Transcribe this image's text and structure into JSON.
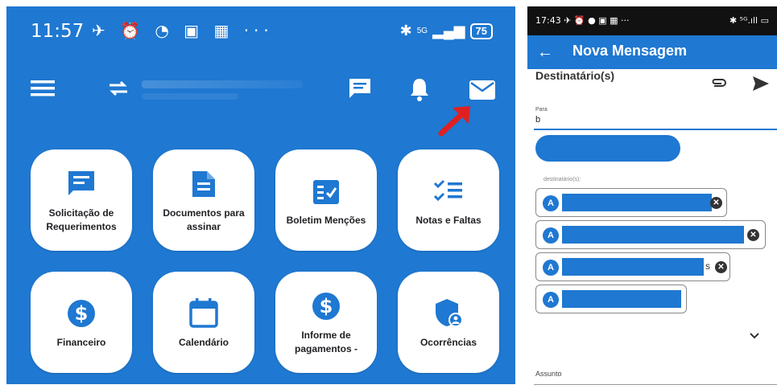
{
  "left_screen": {
    "status_bar": {
      "time": "11:57",
      "icons": "✈ ⏰ ◔ ▣ ▦ ···",
      "network": "5G",
      "battery": "75"
    },
    "app_bar": {
      "menu_icon": "menu-icon",
      "swap_icon": "swap-icon",
      "chat_icon": "chat-icon",
      "bell_icon": "bell-icon",
      "mail_icon": "mail-icon"
    },
    "tiles": [
      {
        "label": "Solicitação de\nRequerimentos",
        "icon": "chat-bubble-icon"
      },
      {
        "label": "Documentos para\nassinar",
        "icon": "document-icon"
      },
      {
        "label": "Boletim Menções",
        "icon": "grade-report-icon"
      },
      {
        "label": "Notas e Faltas",
        "icon": "checklist-icon"
      },
      {
        "label": "Financeiro",
        "icon": "dollar-icon"
      },
      {
        "label": "Calendário",
        "icon": "calendar-icon"
      },
      {
        "label": "Informe de\npagamentos -",
        "icon": "dollar-icon"
      },
      {
        "label": "Ocorrências",
        "icon": "shield-user-icon"
      }
    ]
  },
  "right_screen": {
    "status_bar": {
      "time": "17:43",
      "icons": "✈ ⏰ ● ▣ ▦ ···",
      "signal": "✱ ⁵ᴳ.ıll ▭"
    },
    "app_bar": {
      "back_label": "←",
      "title": "Nova Mensagem"
    },
    "recipients_header": "Destinatário(s)",
    "para_label": "Para",
    "para_value": "b",
    "recipients_label": "destinatário(s):",
    "recipients": [
      {
        "initial": "A",
        "partial": "A"
      },
      {
        "initial": "A",
        "partial": "A"
      },
      {
        "initial": "A",
        "suffix": "s"
      },
      {
        "initial": "A",
        "partial": "A"
      }
    ],
    "subject_label": "Assunto"
  },
  "colors": {
    "primary": "#1f78d1",
    "annotation_arrow": "#e02020"
  }
}
